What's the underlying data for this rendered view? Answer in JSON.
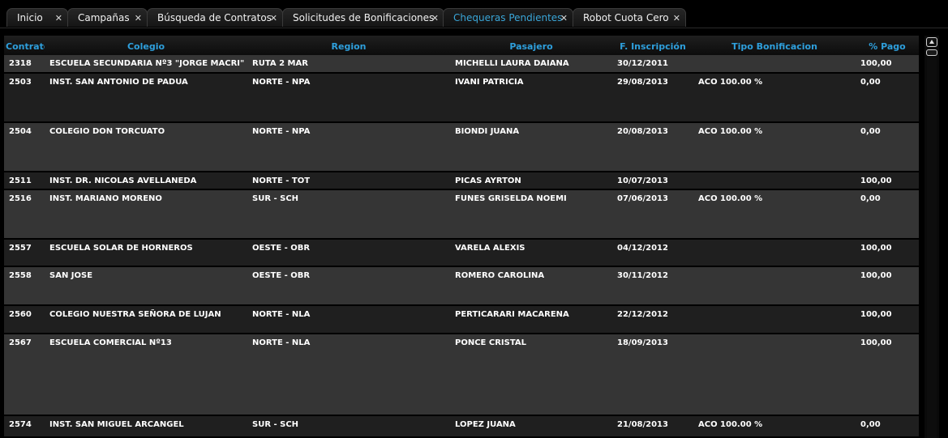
{
  "tabs": [
    {
      "label": "Inicio",
      "active": false
    },
    {
      "label": "Campañas",
      "active": false
    },
    {
      "label": "Búsqueda de Contratos",
      "active": false
    },
    {
      "label": "Solicitudes de Bonificaciones",
      "active": false
    },
    {
      "label": "Chequeras Pendientes",
      "active": true
    },
    {
      "label": "Robot Cuota Cero",
      "active": false
    }
  ],
  "close_glyph": "✕",
  "columns": [
    "Contrato",
    "Colegio",
    "Region",
    "Pasajero",
    "F. Inscripción",
    "Tipo Bonificacion",
    "% Pago"
  ],
  "rows": [
    [
      "2318",
      "ESCUELA SECUNDARIA Nº3 \"JORGE MACRI\"",
      "RUTA 2  MAR",
      "MICHELLI LAURA DAIANA",
      "30/12/2011",
      "",
      "100,00"
    ],
    [
      "2503",
      "INST. SAN ANTONIO DE PADUA",
      "NORTE - NPA",
      "IVANI PATRICIA",
      "29/08/2013",
      "ACO 100.00 %",
      "0,00"
    ],
    [
      "2504",
      "COLEGIO DON TORCUATO",
      "NORTE - NPA",
      "BIONDI JUANA",
      "20/08/2013",
      "ACO 100.00 %",
      "0,00"
    ],
    [
      "2511",
      "INST. DR. NICOLAS AVELLANEDA",
      "NORTE - TOT",
      "PICAS AYRTON",
      "10/07/2013",
      "",
      "100,00"
    ],
    [
      "2516",
      "INST. MARIANO MORENO",
      "SUR - SCH",
      "FUNES GRISELDA NOEMI",
      "07/06/2013",
      "ACO 100.00 %",
      "0,00"
    ],
    [
      "2557",
      "ESCUELA SOLAR DE HORNEROS",
      "OESTE - OBR",
      "VARELA ALEXIS",
      "04/12/2012",
      "",
      "100,00"
    ],
    [
      "2558",
      "SAN JOSE",
      "OESTE - OBR",
      "ROMERO CAROLINA",
      "30/11/2012",
      "",
      "100,00"
    ],
    [
      "2560",
      "COLEGIO NUESTRA SEÑORA DE LUJAN",
      "NORTE - NLA",
      "PERTICARARI MACARENA",
      "22/12/2012",
      "",
      "100,00"
    ],
    [
      "2567",
      "ESCUELA COMERCIAL Nº13",
      "NORTE - NLA",
      "PONCE CRISTAL",
      "18/09/2013",
      "",
      "100,00"
    ],
    [
      "2574",
      "INST. SAN MIGUEL ARCANGEL",
      "SUR - SCH",
      "LOPEZ JUANA",
      "21/08/2013",
      "ACO 100.00 %",
      "0,00"
    ]
  ]
}
